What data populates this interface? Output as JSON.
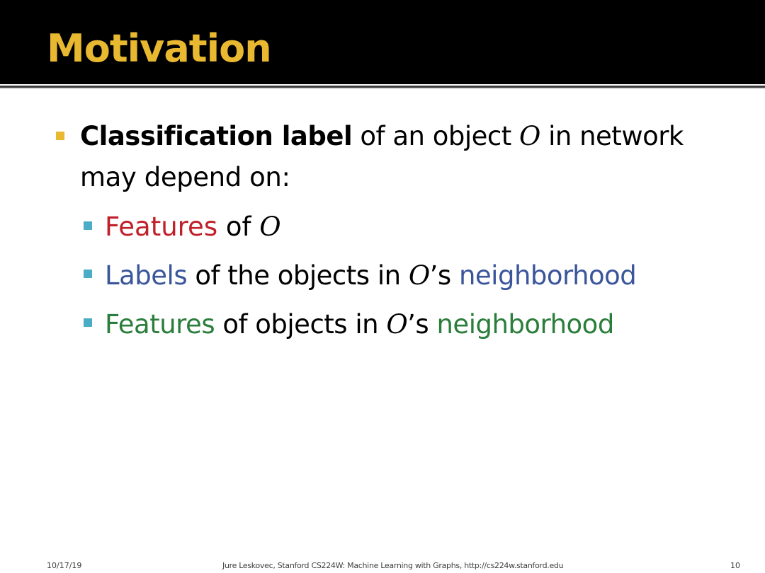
{
  "slide": {
    "title": "Motivation",
    "bullet_main": {
      "bold": "Classification label",
      "text_1": " of an object ",
      "var": "O",
      "text_2": " in network",
      "line_2": "may depend on:"
    },
    "sub_bullets": [
      {
        "colored": "Features",
        "text": " of ",
        "var": "O"
      },
      {
        "colored_1": "Labels",
        "text_1": " of the objects in ",
        "var": "O",
        "text_2": "’s ",
        "colored_2": "neighborhood"
      },
      {
        "colored_1": "Features",
        "text_1": " of objects in ",
        "var": "O",
        "text_2": "’s ",
        "colored_2": "neighborhood"
      }
    ]
  },
  "footer": {
    "date": "10/17/19",
    "center": "Jure Leskovec, Stanford CS224W: Machine Learning with Graphs, http://cs224w.stanford.edu",
    "page": "10"
  },
  "colors": {
    "title": "#e8b830",
    "main_bullet": "#e8b830",
    "sub_bullet": "#4bacc6",
    "red": "#c0202a",
    "blue": "#3a559a",
    "green": "#2a7d3a"
  }
}
